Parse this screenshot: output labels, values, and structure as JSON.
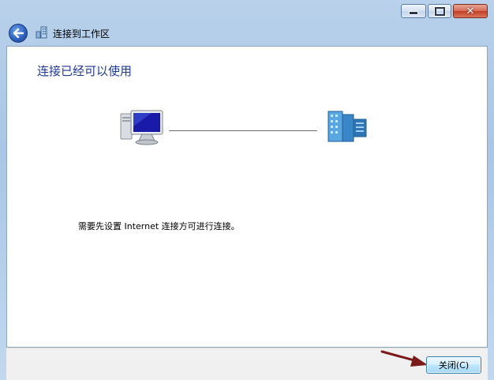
{
  "window": {
    "caption_buttons": {
      "minimize_icon": "minimize-icon",
      "maximize_icon": "maximize-icon",
      "close_icon": "close-icon",
      "close_glyph": "✕"
    },
    "nav_title": "连接到工作区",
    "back_icon": "back-arrow-icon",
    "nav_icon": "workspace-icon"
  },
  "main": {
    "heading": "连接已经可以使用",
    "computer_icon": "computer-icon",
    "network_icon": "workplace-network-icon",
    "message": "需要先设置 Internet 连接方可进行连接。"
  },
  "footer": {
    "close_button_label": "关闭(C)"
  },
  "colors": {
    "heading": "#1f3a93",
    "arrow": "#7a1a1a"
  }
}
